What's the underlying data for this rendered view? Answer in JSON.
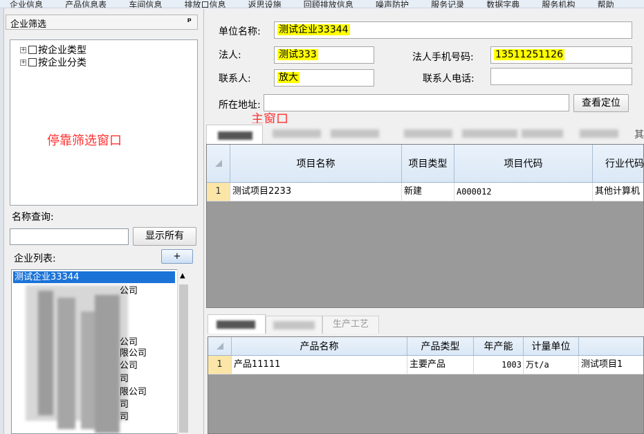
{
  "menubar": [
    "企业信息",
    "产品信息表",
    "车间信息",
    "排放口信息",
    "返思设施",
    "回顾排放信息",
    "噪声防护",
    "服务记录",
    "数据字典",
    "服务机构",
    "帮助"
  ],
  "dock": {
    "title": "企业筛选",
    "pin": "ᵖ",
    "tree": [
      {
        "label": "按企业类型"
      },
      {
        "label": "按企业分类"
      }
    ],
    "annotation": "停靠筛选窗口",
    "name_query_label": "名称查询:",
    "name_query_value": "",
    "show_all_label": "显示所有",
    "company_list_label": "企业列表:",
    "add_label": "+",
    "selected_company": "测试企业33344",
    "company_suffixes": [
      "公司",
      "公司",
      "限公司",
      "公司",
      "司",
      "限公司",
      "司",
      "司"
    ]
  },
  "form": {
    "unit_name_label": "单位名称:",
    "unit_name_value": "测试企业33344",
    "legal_person_label": "法人:",
    "legal_person_value": "测试333",
    "legal_phone_label": "法人手机号码:",
    "legal_phone_value": "13511251126",
    "contact_label": "联系人:",
    "contact_value": "放大",
    "contact_phone_label": "联系人电话:",
    "contact_phone_value": "",
    "address_label": "所在地址:",
    "address_value": "",
    "locate_label": "查看定位",
    "main_annotation": "主窗口"
  },
  "tabs_top_end": "其",
  "project_grid": {
    "columns": [
      "项目名称",
      "项目类型",
      "项目代码",
      "行业代码"
    ],
    "rows": [
      {
        "num": "1",
        "name": "测试项目2233",
        "type": "新建",
        "code": "A000012",
        "industry": "其他计算机"
      }
    ]
  },
  "subtabs": [
    "",
    "",
    "生产工艺"
  ],
  "product_grid": {
    "columns": [
      "产品名称",
      "产品类型",
      "年产能",
      "计量单位",
      ""
    ],
    "rows": [
      {
        "num": "1",
        "name": "产品11111",
        "type": "主要产品",
        "capacity": "1003",
        "unit": "万t/a",
        "project": "测试项目1"
      }
    ]
  }
}
